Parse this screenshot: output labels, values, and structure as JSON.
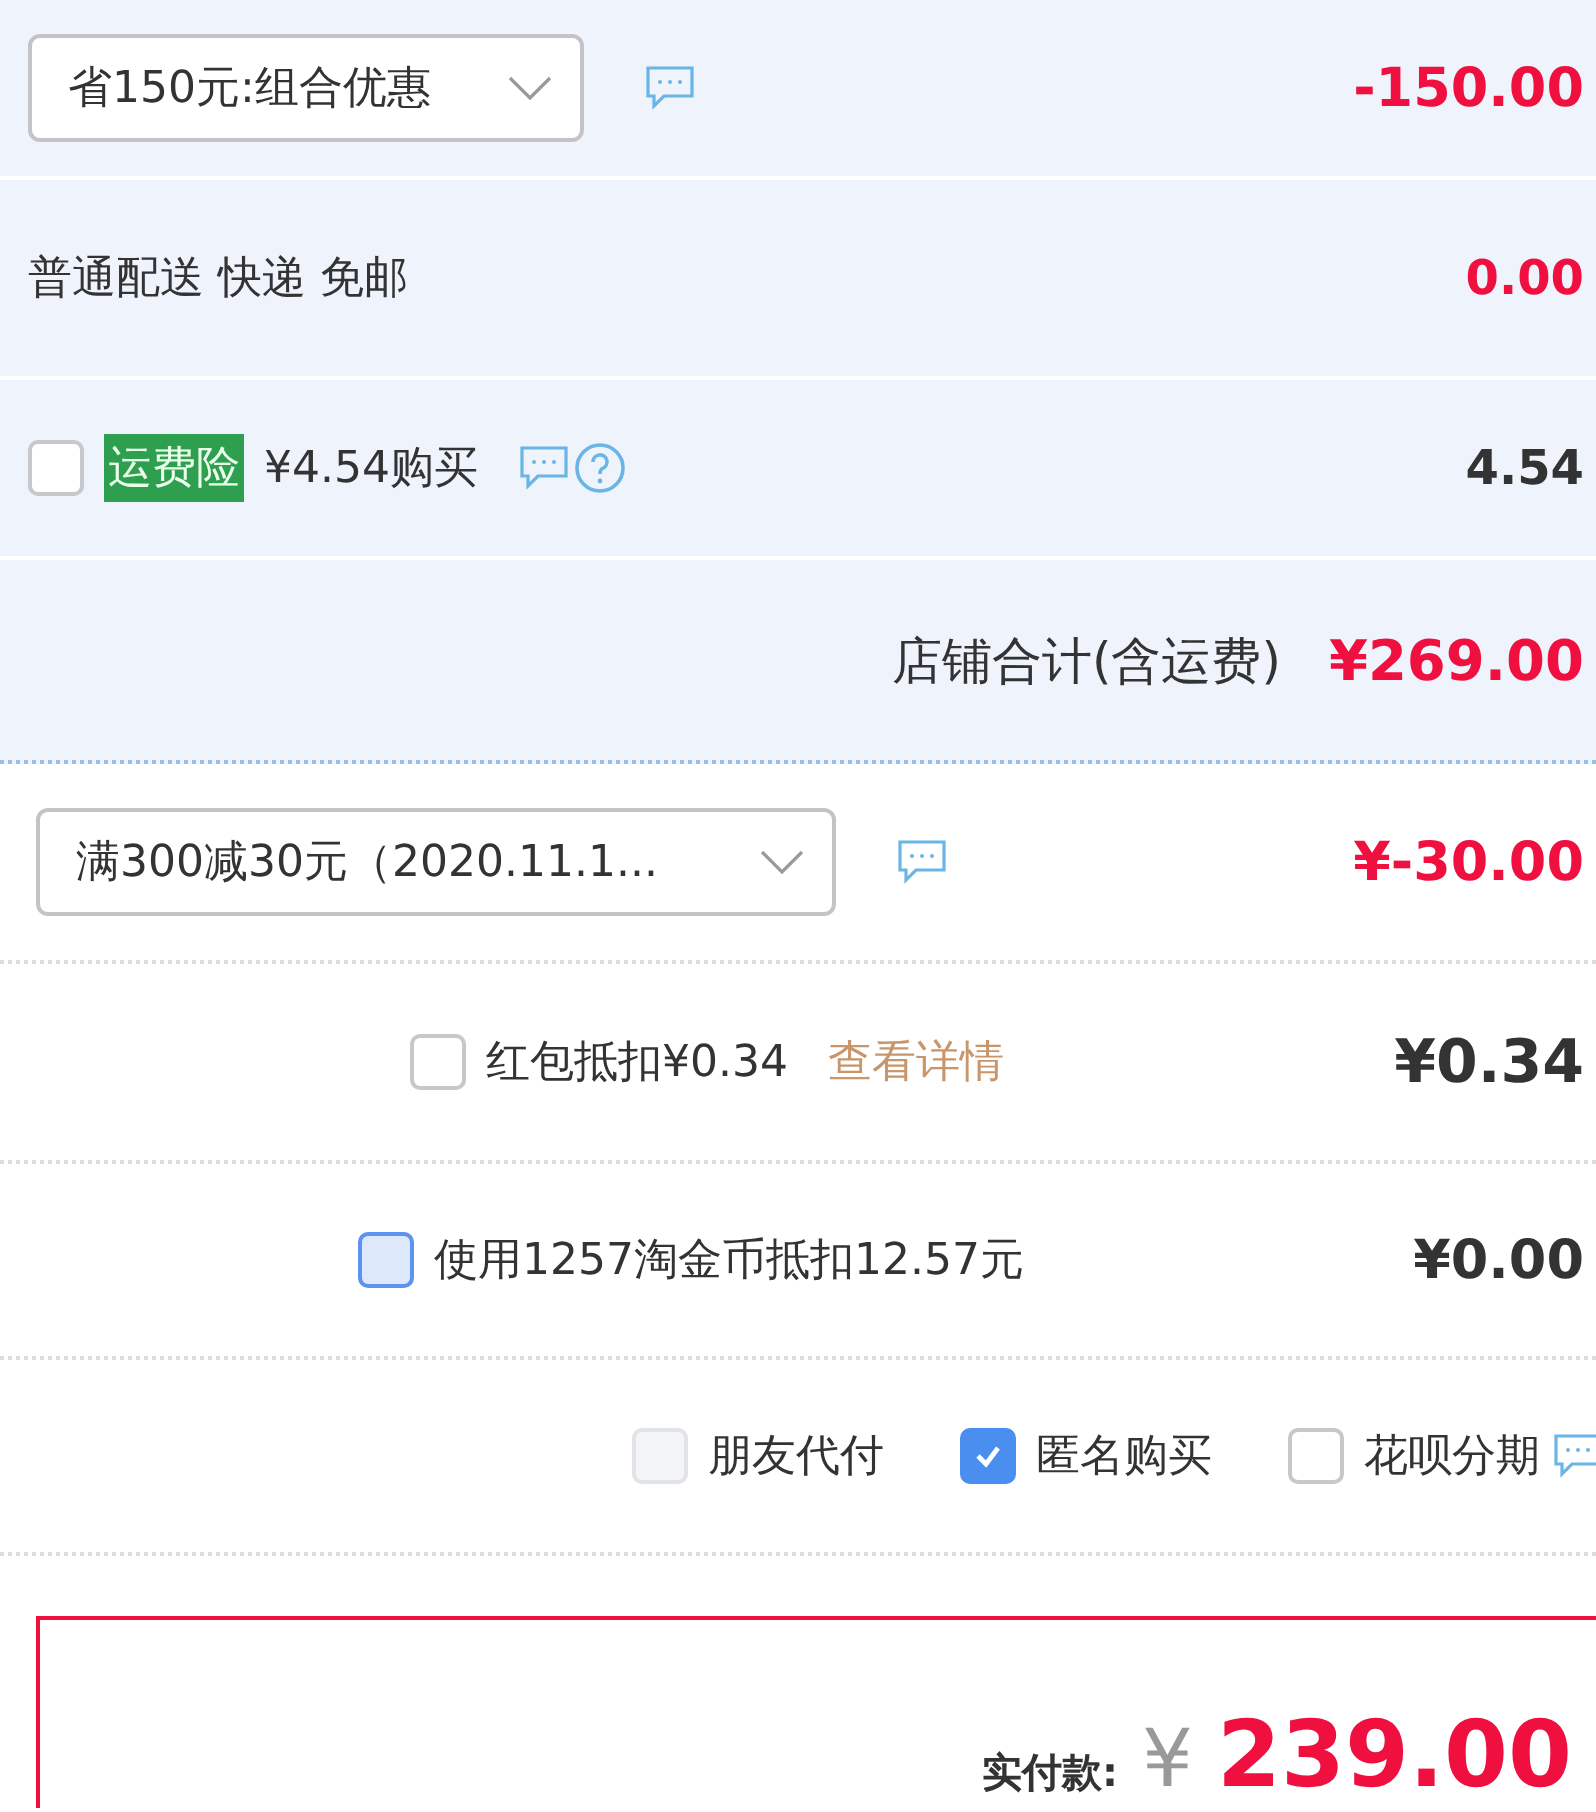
{
  "shop_section": {
    "promo": {
      "value": "省150元:组合优惠",
      "amount": "-150.00"
    },
    "delivery": {
      "label": "普通配送 快递 免邮",
      "amount": "0.00"
    },
    "insurance": {
      "checked": false,
      "tag": "运费险",
      "label": "¥4.54购买",
      "amount": "4.54"
    },
    "total": {
      "label": "店铺合计(含运费)",
      "amount": "¥269.00"
    }
  },
  "coupon": {
    "value": "满300减30元（2020.11.1...",
    "amount": "¥-30.00"
  },
  "red_packet": {
    "checked": false,
    "label": "红包抵扣¥0.34",
    "link": "查看详情",
    "amount": "¥0.34"
  },
  "coins": {
    "checked": false,
    "focused": true,
    "label": "使用1257淘金币抵扣12.57元",
    "amount": "¥0.00"
  },
  "options": [
    {
      "label": "朋友代付",
      "checked": false,
      "disabled": true,
      "chat": false
    },
    {
      "label": "匿名购买",
      "checked": true,
      "disabled": false,
      "chat": false
    },
    {
      "label": "花呗分期",
      "checked": false,
      "disabled": false,
      "chat": true
    }
  ],
  "payment": {
    "label": "实付款:",
    "currency": "¥",
    "amount": "239.00"
  }
}
